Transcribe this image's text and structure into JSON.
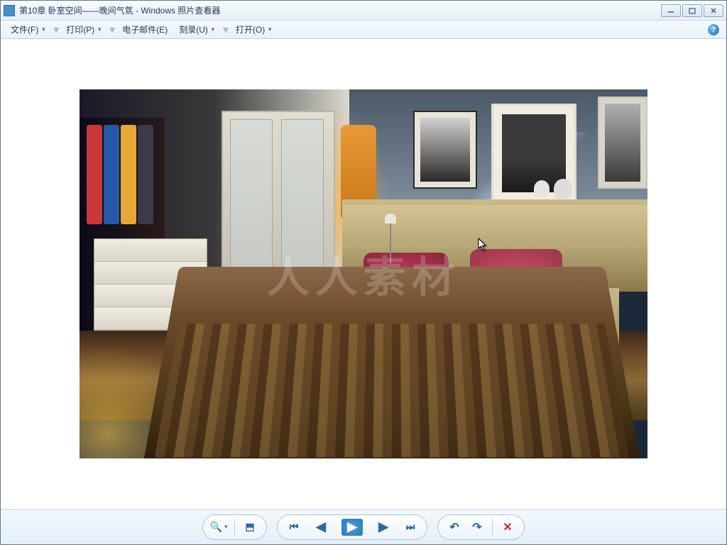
{
  "titlebar": {
    "title": "第10章  卧室空间——晚间气氛 - Windows 照片查看器"
  },
  "menubar": {
    "file": "文件(F)",
    "print": "打印(P)",
    "email": "电子邮件(E)",
    "burn": "刻录(U)",
    "open": "打开(O)"
  },
  "watermark": "人人素材",
  "toolbar": {
    "zoom_tip": "更改显示大小",
    "fit_tip": "实际大小",
    "prev_tip": "上一个",
    "next_tip": "下一个",
    "slideshow_tip": "播放幻灯片",
    "rotate_ccw_tip": "逆时针旋转",
    "rotate_cw_tip": "顺时针旋转",
    "delete_tip": "删除"
  }
}
